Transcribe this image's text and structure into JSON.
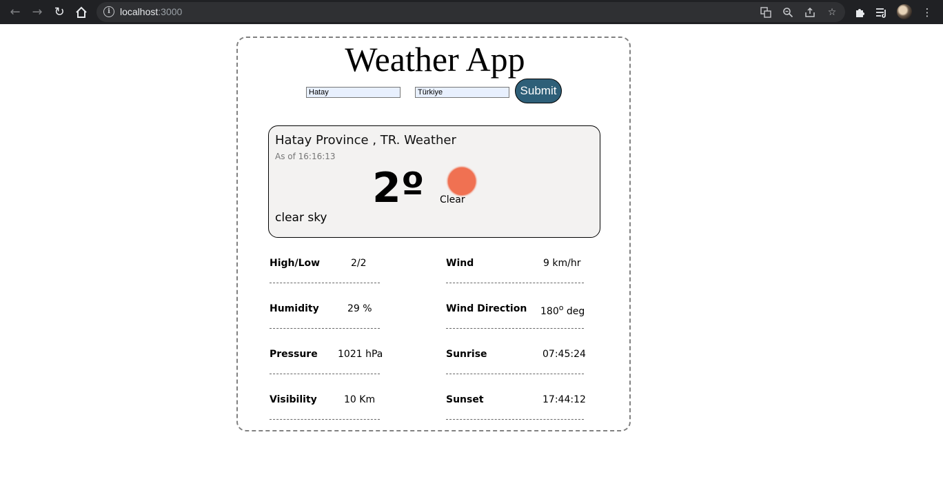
{
  "browser": {
    "url_host": "localhost",
    "url_port": ":3000"
  },
  "app": {
    "title": "Weather App",
    "city_input": "Hatay",
    "country_input": "Türkiye",
    "submit_label": "Submit"
  },
  "weather": {
    "location": "Hatay Province , TR. Weather",
    "as_of": "As of 16:16:13",
    "temperature": "2º",
    "condition": "Clear",
    "description": "clear sky",
    "icon_color": "#f07152"
  },
  "details": {
    "high_low": {
      "label": "High/Low",
      "value": "2/2"
    },
    "humidity": {
      "label": "Humidity",
      "value": "29 %"
    },
    "pressure": {
      "label": "Pressure",
      "value": "1021 hPa"
    },
    "visibility": {
      "label": "Visibility",
      "value": "10 Km"
    },
    "wind": {
      "label": "Wind",
      "value": "9 km/hr"
    },
    "wind_direction": {
      "label": "Wind Direction",
      "value_num": "180",
      "value_sup": "o",
      "value_unit": " deg"
    },
    "sunrise": {
      "label": "Sunrise",
      "value": "07:45:24"
    },
    "sunset": {
      "label": "Sunset",
      "value": "17:44:12"
    }
  }
}
